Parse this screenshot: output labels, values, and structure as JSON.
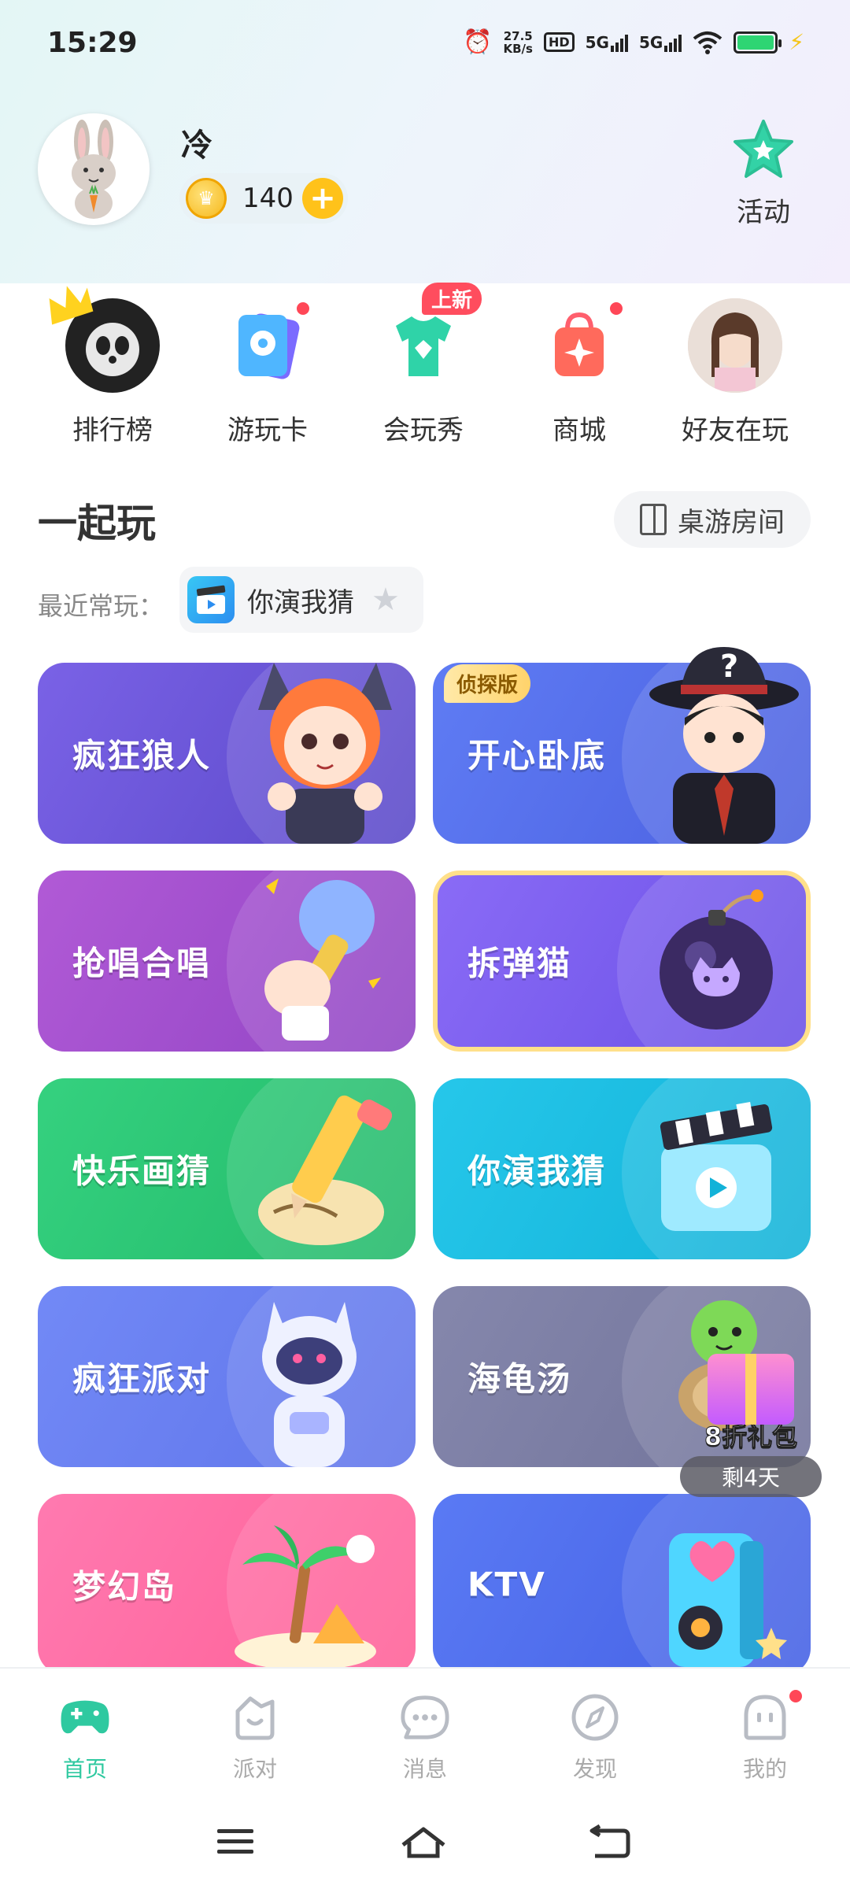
{
  "status_bar": {
    "time": "15:29",
    "speed_value": "27.5",
    "speed_unit": "KB/s",
    "hd_label": "HD",
    "net1": "5G",
    "net2": "5G"
  },
  "profile": {
    "username": "冷",
    "coins": "140",
    "activity_label": "活动"
  },
  "quick_entries": [
    {
      "label": "排行榜"
    },
    {
      "label": "游玩卡"
    },
    {
      "label": "会玩秀",
      "badge": "上新"
    },
    {
      "label": "商城"
    },
    {
      "label": "好友在玩"
    }
  ],
  "section": {
    "title": "一起玩",
    "room_button": "桌游房间",
    "recent_label": "最近常玩：",
    "recent_game": "你演我猜"
  },
  "games": [
    {
      "title": "疯狂狼人",
      "color": "#6f57d8"
    },
    {
      "title": "开心卧底",
      "color": "#5b6ff0",
      "tag": "侦探版"
    },
    {
      "title": "抢唱合唱",
      "color": "#a44fd0"
    },
    {
      "title": "拆弹猫",
      "color": "#7a5cf0"
    },
    {
      "title": "快乐画猜",
      "color": "#2ec77c"
    },
    {
      "title": "你演我猜",
      "color": "#1fc3e3"
    },
    {
      "title": "疯狂派对",
      "color": "#6a7ff2"
    },
    {
      "title": "海龟汤",
      "color": "#7f81a8"
    },
    {
      "title": "梦幻岛",
      "color": "#ff6fa6"
    },
    {
      "title": "KTV",
      "color": "#4f6ff0"
    }
  ],
  "promo": {
    "title": "8折礼包",
    "days_left": "剩4天"
  },
  "bottom_nav": [
    {
      "label": "首页",
      "active": true
    },
    {
      "label": "派对"
    },
    {
      "label": "消息"
    },
    {
      "label": "发现"
    },
    {
      "label": "我的"
    }
  ],
  "colors": {
    "accent": "#2fc9a0",
    "badge_red": "#ff4d5e",
    "coin_gold": "#ffc21a"
  }
}
